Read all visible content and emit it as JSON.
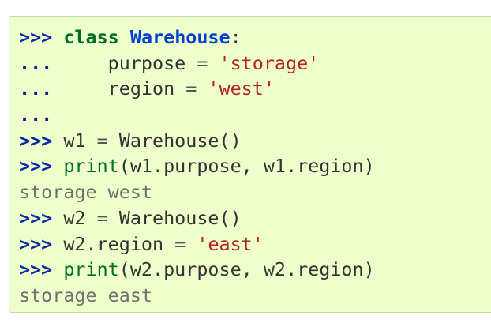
{
  "code_lines": [
    {
      "prompt": ">>>",
      "parts": [
        "class",
        " ",
        "Warehouse",
        ":"
      ]
    },
    {
      "prompt": "...",
      "parts": [
        "    purpose",
        " = ",
        "'storage'"
      ]
    },
    {
      "prompt": "...",
      "parts": [
        "    region",
        " = ",
        "'west'"
      ]
    },
    {
      "prompt": "...",
      "parts": []
    },
    {
      "prompt": ">>>",
      "parts": [
        "w1",
        " = ",
        "Warehouse()"
      ]
    },
    {
      "prompt": ">>>",
      "parts": [
        "print",
        "(w1.purpose, w1.region)"
      ]
    },
    {
      "output": "storage west"
    },
    {
      "prompt": ">>>",
      "parts": [
        "w2",
        " = ",
        "Warehouse()"
      ]
    },
    {
      "prompt": ">>>",
      "parts": [
        "w2.region",
        " = ",
        "'east'"
      ]
    },
    {
      "prompt": ">>>",
      "parts": [
        "print",
        "(w2.purpose, w2.region)"
      ]
    },
    {
      "output": "storage east"
    }
  ],
  "colors": {
    "background": "#eeffcc",
    "border": "#c2d8a8",
    "prompt": "#0a29a5",
    "keyword": "#007020",
    "class_name": "#0040d0",
    "string": "#b3261e",
    "output": "#707070"
  }
}
